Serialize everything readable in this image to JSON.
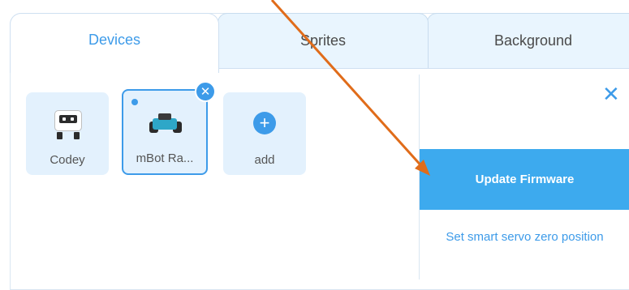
{
  "tabs": {
    "devices": "Devices",
    "sprites": "Sprites",
    "background": "Background"
  },
  "devices": [
    {
      "label": "Codey",
      "icon": "codey-robot-icon",
      "selected": false
    },
    {
      "label": "mBot Ra...",
      "icon": "mbot-robot-icon",
      "selected": true
    },
    {
      "label": "add",
      "icon": "plus-circle-icon",
      "selected": false
    }
  ],
  "side_panel": {
    "update_firmware": "Update Firmware",
    "servo_zero": "Set smart servo zero position"
  },
  "colors": {
    "accent": "#3d9be9",
    "button": "#3daaee",
    "tile_bg": "#e3f1fd",
    "tab_bg": "#e9f5fe",
    "annotation_arrow": "#e06c1a"
  }
}
